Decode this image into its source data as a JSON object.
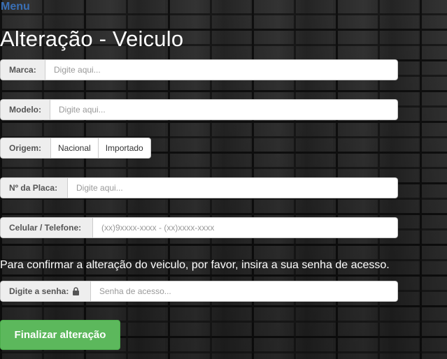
{
  "nav": {
    "menu_label": "Menu"
  },
  "page": {
    "title": "Alteração - Veiculo"
  },
  "form": {
    "marca": {
      "label": "Marca:",
      "placeholder": "Digite aqui..."
    },
    "modelo": {
      "label": "Modelo:",
      "placeholder": "Digite aqui..."
    },
    "origem": {
      "label": "Origem:",
      "options": [
        "Nacional",
        "Importado"
      ]
    },
    "placa": {
      "label": "Nº da Placa:",
      "placeholder": "Digite aqui..."
    },
    "telefone": {
      "label": "Celular / Telefone:",
      "placeholder": "(xx)9xxxx-xxxx - (xx)xxxx-xxxx"
    },
    "confirm_text": "Para confirmar a alteração do veiculo, por favor, insira a sua senha de acesso.",
    "senha": {
      "label": "Digite a senha:",
      "placeholder": "Senha de acesso...",
      "icon": "lock-icon"
    },
    "submit_label": "Finalizar alteração"
  },
  "colors": {
    "menu": "#3a6fb5",
    "submit": "#5cb85c",
    "addon_bg": "#eeeeee"
  }
}
